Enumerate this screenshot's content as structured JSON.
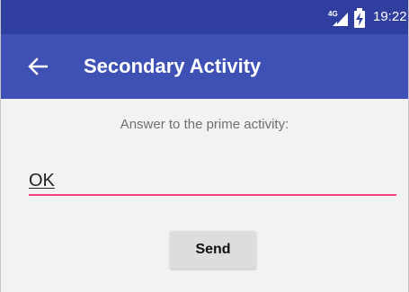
{
  "status_bar": {
    "network_label": "4G",
    "signal_icon": "signal-4g-icon",
    "battery_icon": "battery-charging-icon",
    "time": "19:22",
    "background_color": "#303f9f"
  },
  "app_bar": {
    "back_icon": "back-arrow-icon",
    "title": "Secondary Activity",
    "background_color": "#3f51b5"
  },
  "form": {
    "prompt": "Answer to the prime activity:",
    "answer_value": "OK",
    "answer_underline_color": "#ff4081",
    "send_label": "Send"
  }
}
